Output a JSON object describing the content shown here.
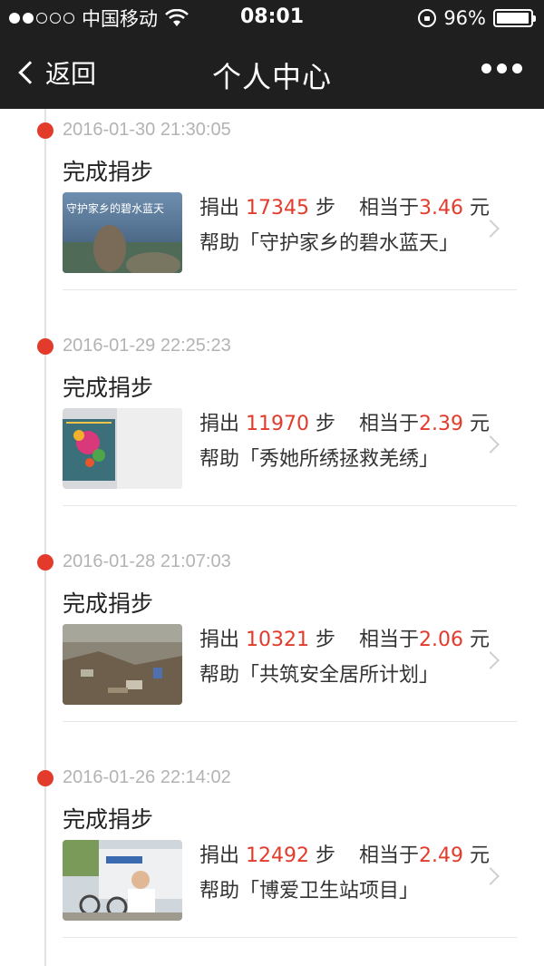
{
  "status_bar": {
    "carrier": "中国移动",
    "time": "08:01",
    "battery": "96%",
    "battery_level": 0.96,
    "signal_bars_filled": 2,
    "icons": [
      "signal-dots-icon",
      "wifi-icon",
      "rotation-lock-icon",
      "battery-icon"
    ]
  },
  "nav": {
    "back_label": "返回",
    "title": "个人中心",
    "more_icon": "more-dots-icon"
  },
  "colors": {
    "accent_red": "#e33b2b",
    "bar_bg": "#1f1f20",
    "timestamp_gray": "#b3b3b3"
  },
  "entries": [
    {
      "timestamp": "2016-01-30 21:30:05",
      "action": "完成捐步",
      "donate_label": "捐出",
      "steps": "17345",
      "steps_unit": "步",
      "equiv_label": "相当于",
      "amount": "3.46",
      "amount_unit": "元",
      "project_line": "帮助「守护家乡的碧水蓝天」",
      "thumb_caption": "守护家乡的碧水蓝天"
    },
    {
      "timestamp": "2016-01-29 22:25:23",
      "action": "完成捐步",
      "donate_label": "捐出",
      "steps": "11970",
      "steps_unit": "步",
      "equiv_label": "相当于",
      "amount": "2.39",
      "amount_unit": "元",
      "project_line": "帮助「秀她所绣拯救羌绣」"
    },
    {
      "timestamp": "2016-01-28 21:07:03",
      "action": "完成捐步",
      "donate_label": "捐出",
      "steps": "10321",
      "steps_unit": "步",
      "equiv_label": "相当于",
      "amount": "2.06",
      "amount_unit": "元",
      "project_line": "帮助「共筑安全居所计划」"
    },
    {
      "timestamp": "2016-01-26 22:14:02",
      "action": "完成捐步",
      "donate_label": "捐出",
      "steps": "12492",
      "steps_unit": "步",
      "equiv_label": "相当于",
      "amount": "2.49",
      "amount_unit": "元",
      "project_line": "帮助「博爱卫生站项目」"
    }
  ]
}
